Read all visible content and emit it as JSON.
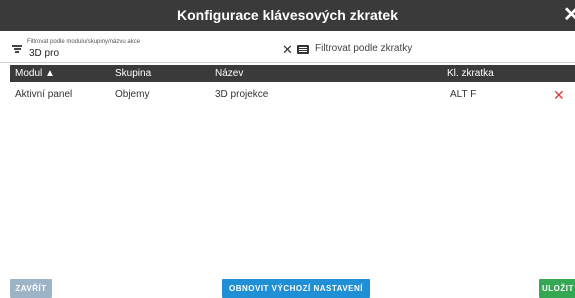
{
  "window": {
    "title": "Konfigurace klávesových zkratek",
    "close_glyph": "✕",
    "close_icon": "close-icon"
  },
  "filter": {
    "label": "Filtrovat podle modulu/skupiny/názvu akce",
    "value": "3D pro",
    "filter_icon": "filter-lines-icon",
    "clear_glyph": "✕",
    "clear_icon": "clear-icon",
    "keyboard_icon": "keyboard-icon",
    "shortcut_filter_label": "Filtrovat podle zkratky"
  },
  "table": {
    "columns": [
      {
        "label": "Modul ▲"
      },
      {
        "label": "Skupina"
      },
      {
        "label": "Název"
      },
      {
        "label": "Kl. zkratka"
      }
    ],
    "rows": [
      {
        "modul": "Aktivní panel",
        "skupina": "Objemy",
        "nazev": "3D projekce",
        "zkratka": "ALT F",
        "delete_glyph": "✕"
      }
    ]
  },
  "footer": {
    "close_label": "ZAVŘÍT",
    "reset_label": "OBNOVIT VÝCHOZÍ NASTAVENÍ",
    "save_label": "ULOŽIT"
  },
  "colors": {
    "header_bg": "#3a3a3a",
    "delete": "#e53935",
    "close_button": "#9db4c7",
    "reset_button": "#1f8fd6",
    "save_button": "#35a853"
  }
}
